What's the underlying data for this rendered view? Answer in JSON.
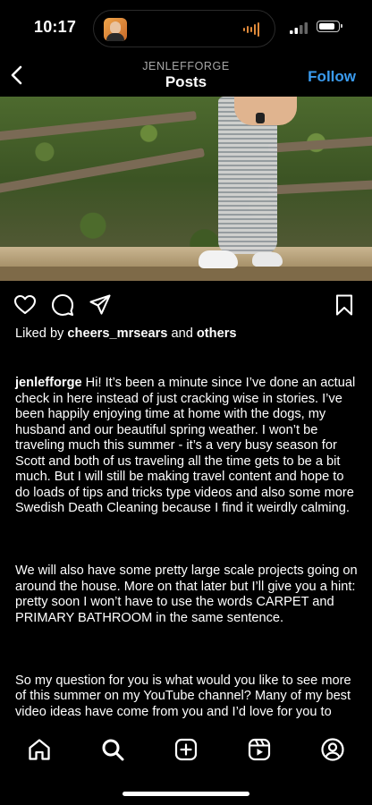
{
  "status_bar": {
    "time": "10:17",
    "battery_level": 0.85
  },
  "header": {
    "username": "JENLEFFORGE",
    "title": "Posts",
    "follow_label": "Follow"
  },
  "post": {
    "liked_by_prefix": "Liked by",
    "liked_by_user": "cheers_mrsears",
    "liked_by_and": "and",
    "liked_by_others": "others",
    "caption_user": "jenlefforge",
    "caption_p1": "Hi! It’s been a minute since I’ve done an actual check in here instead of just cracking wise in stories. I’ve been happily enjoying time at home with the dogs, my husband and our beautiful spring weather. I won’t be traveling much this summer - it’s a very busy season for Scott and both of us traveling all the time gets to be a bit much. But I will still be making travel content and hope to do loads of tips and tricks type videos and also some more Swedish Death Cleaning because I find it weirdly calming.",
    "caption_p2": "We will also have some pretty large scale projects going on around the house. More on that later but I’ll give you a hint: pretty soon I won’t have to use the words CARPET and PRIMARY BATHROOM in the same sentence.",
    "caption_p3": "So my question for you is what would you like to see more of this summer on my YouTube channel? Many of my best video ideas have come from you and I’d love for you to comment below if you have any suggestions. As always, I’m so honored when you watch and share my content. Because of YOU I’ve been able to create a life I love and I am so very grateful!"
  },
  "icons": {
    "back": "chevron-left-icon",
    "like": "heart-icon",
    "comment": "comment-bubble-icon",
    "share": "paper-plane-icon",
    "save": "bookmark-icon",
    "tabs": [
      "home-icon",
      "search-icon",
      "create-plus-icon",
      "reels-icon",
      "profile-icon"
    ]
  },
  "colors": {
    "accent": "#3a9bef",
    "background": "#000000",
    "text": "#ffffff",
    "muted": "#a8a8a8"
  }
}
